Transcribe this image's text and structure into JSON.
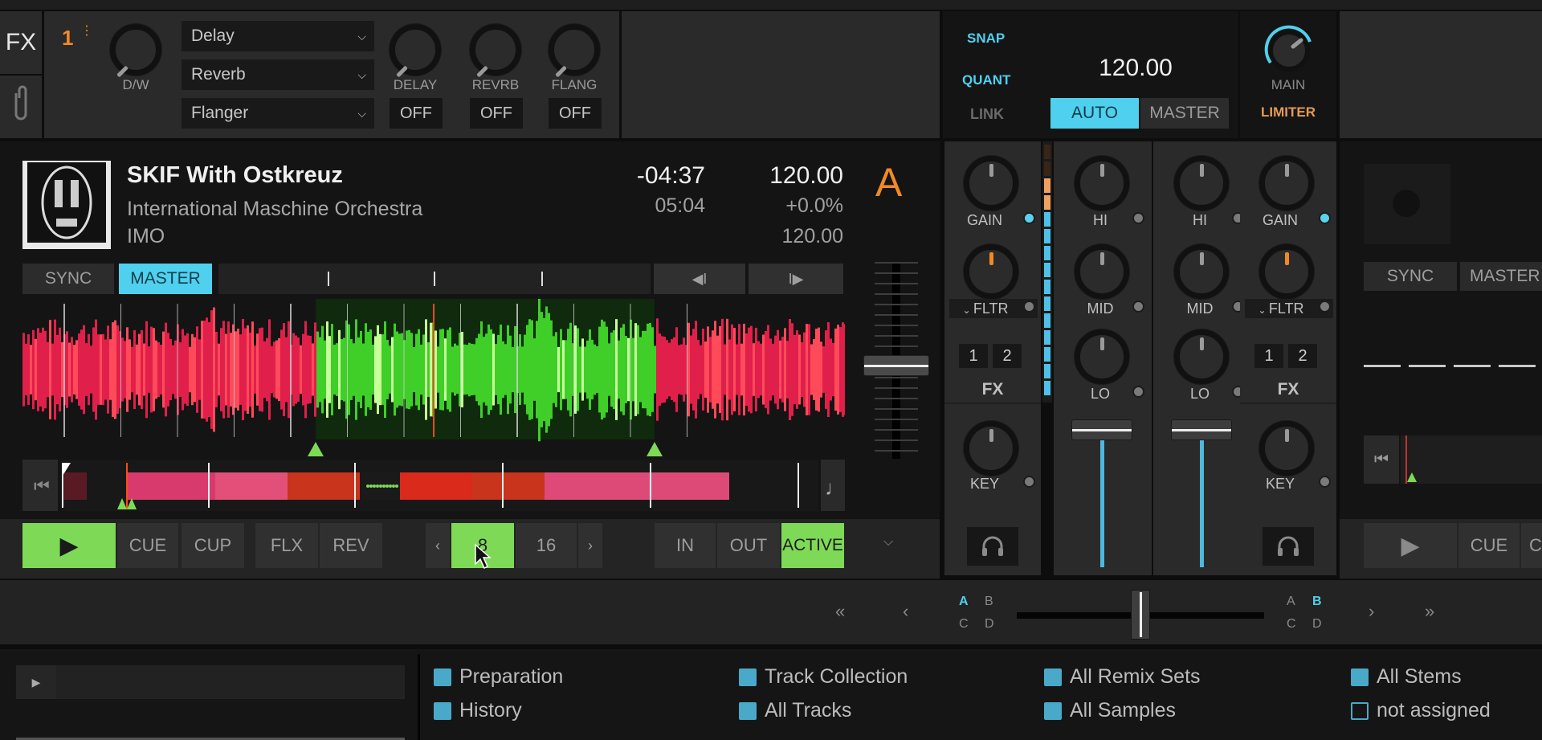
{
  "fx_unit": {
    "tab_label": "FX",
    "unit_number": "1",
    "dry_wet_label": "D/W",
    "effects": [
      {
        "select": "Delay",
        "knob_label": "DELAY",
        "state": "OFF"
      },
      {
        "select": "Reverb",
        "knob_label": "REVRB",
        "state": "OFF"
      },
      {
        "select": "Flanger",
        "knob_label": "FLANG",
        "state": "OFF"
      }
    ]
  },
  "master": {
    "snap": "SNAP",
    "quant": "QUANT",
    "link": "LINK",
    "tempo": "120.00",
    "auto": "AUTO",
    "master": "MASTER",
    "main_label": "MAIN",
    "limiter": "LIMITER"
  },
  "deck_a": {
    "letter": "A",
    "title": "SKIF With Ostkreuz",
    "artist": "International Maschine Orchestra",
    "album": "IMO",
    "remaining": "-04:37",
    "length": "05:04",
    "bpm": "120.00",
    "pitch": "+0.0%",
    "base_bpm": "120.00",
    "sync": "SYNC",
    "master": "MASTER",
    "transport": {
      "play": "play",
      "cue": "CUE",
      "cup": "CUP",
      "flx": "FLX",
      "rev": "REV"
    },
    "loop": {
      "sizes": [
        "8",
        "16"
      ],
      "active_size": "8",
      "in": "IN",
      "out": "OUT",
      "active": "ACTIVE"
    },
    "colors": {
      "accent": "#f08a24",
      "green": "#7ed957",
      "cyan": "#4fd0ee"
    }
  },
  "mixer": {
    "left": {
      "gain": "GAIN",
      "filter": "FLTR",
      "fx1": "1",
      "fx2": "2",
      "fx": "FX",
      "key": "KEY"
    },
    "eq_left": {
      "hi": "HI",
      "mid": "MID",
      "lo": "LO"
    },
    "eq_right": {
      "hi": "HI",
      "mid": "MID",
      "lo": "LO"
    },
    "right": {
      "gain": "GAIN",
      "filter": "FLTR",
      "fx1": "1",
      "fx2": "2",
      "fx": "FX",
      "key": "KEY"
    }
  },
  "deck_b": {
    "sync": "SYNC",
    "master": "MASTER",
    "cue": "CUE",
    "cup_partial": "C"
  },
  "crossfader": {
    "left_assign": {
      "a": "A",
      "b": "B",
      "c": "C",
      "d": "D",
      "selected": "A"
    },
    "right_assign": {
      "a": "A",
      "b": "B",
      "c": "C",
      "d": "D",
      "selected": "B"
    },
    "position": 0.5
  },
  "browser": {
    "items": [
      {
        "label": "Preparation",
        "icon": "preparation-list-icon"
      },
      {
        "label": "History",
        "icon": "history-list-icon"
      },
      {
        "label": "Track Collection",
        "icon": "collection-icon"
      },
      {
        "label": "All Tracks",
        "icon": "folder-icon"
      },
      {
        "label": "All Remix Sets",
        "icon": "remix-folder-icon"
      },
      {
        "label": "All Samples",
        "icon": "folder-icon"
      },
      {
        "label": "All Stems",
        "icon": "stems-icon"
      },
      {
        "label": "not assigned",
        "icon": "playlist-icon"
      }
    ]
  }
}
